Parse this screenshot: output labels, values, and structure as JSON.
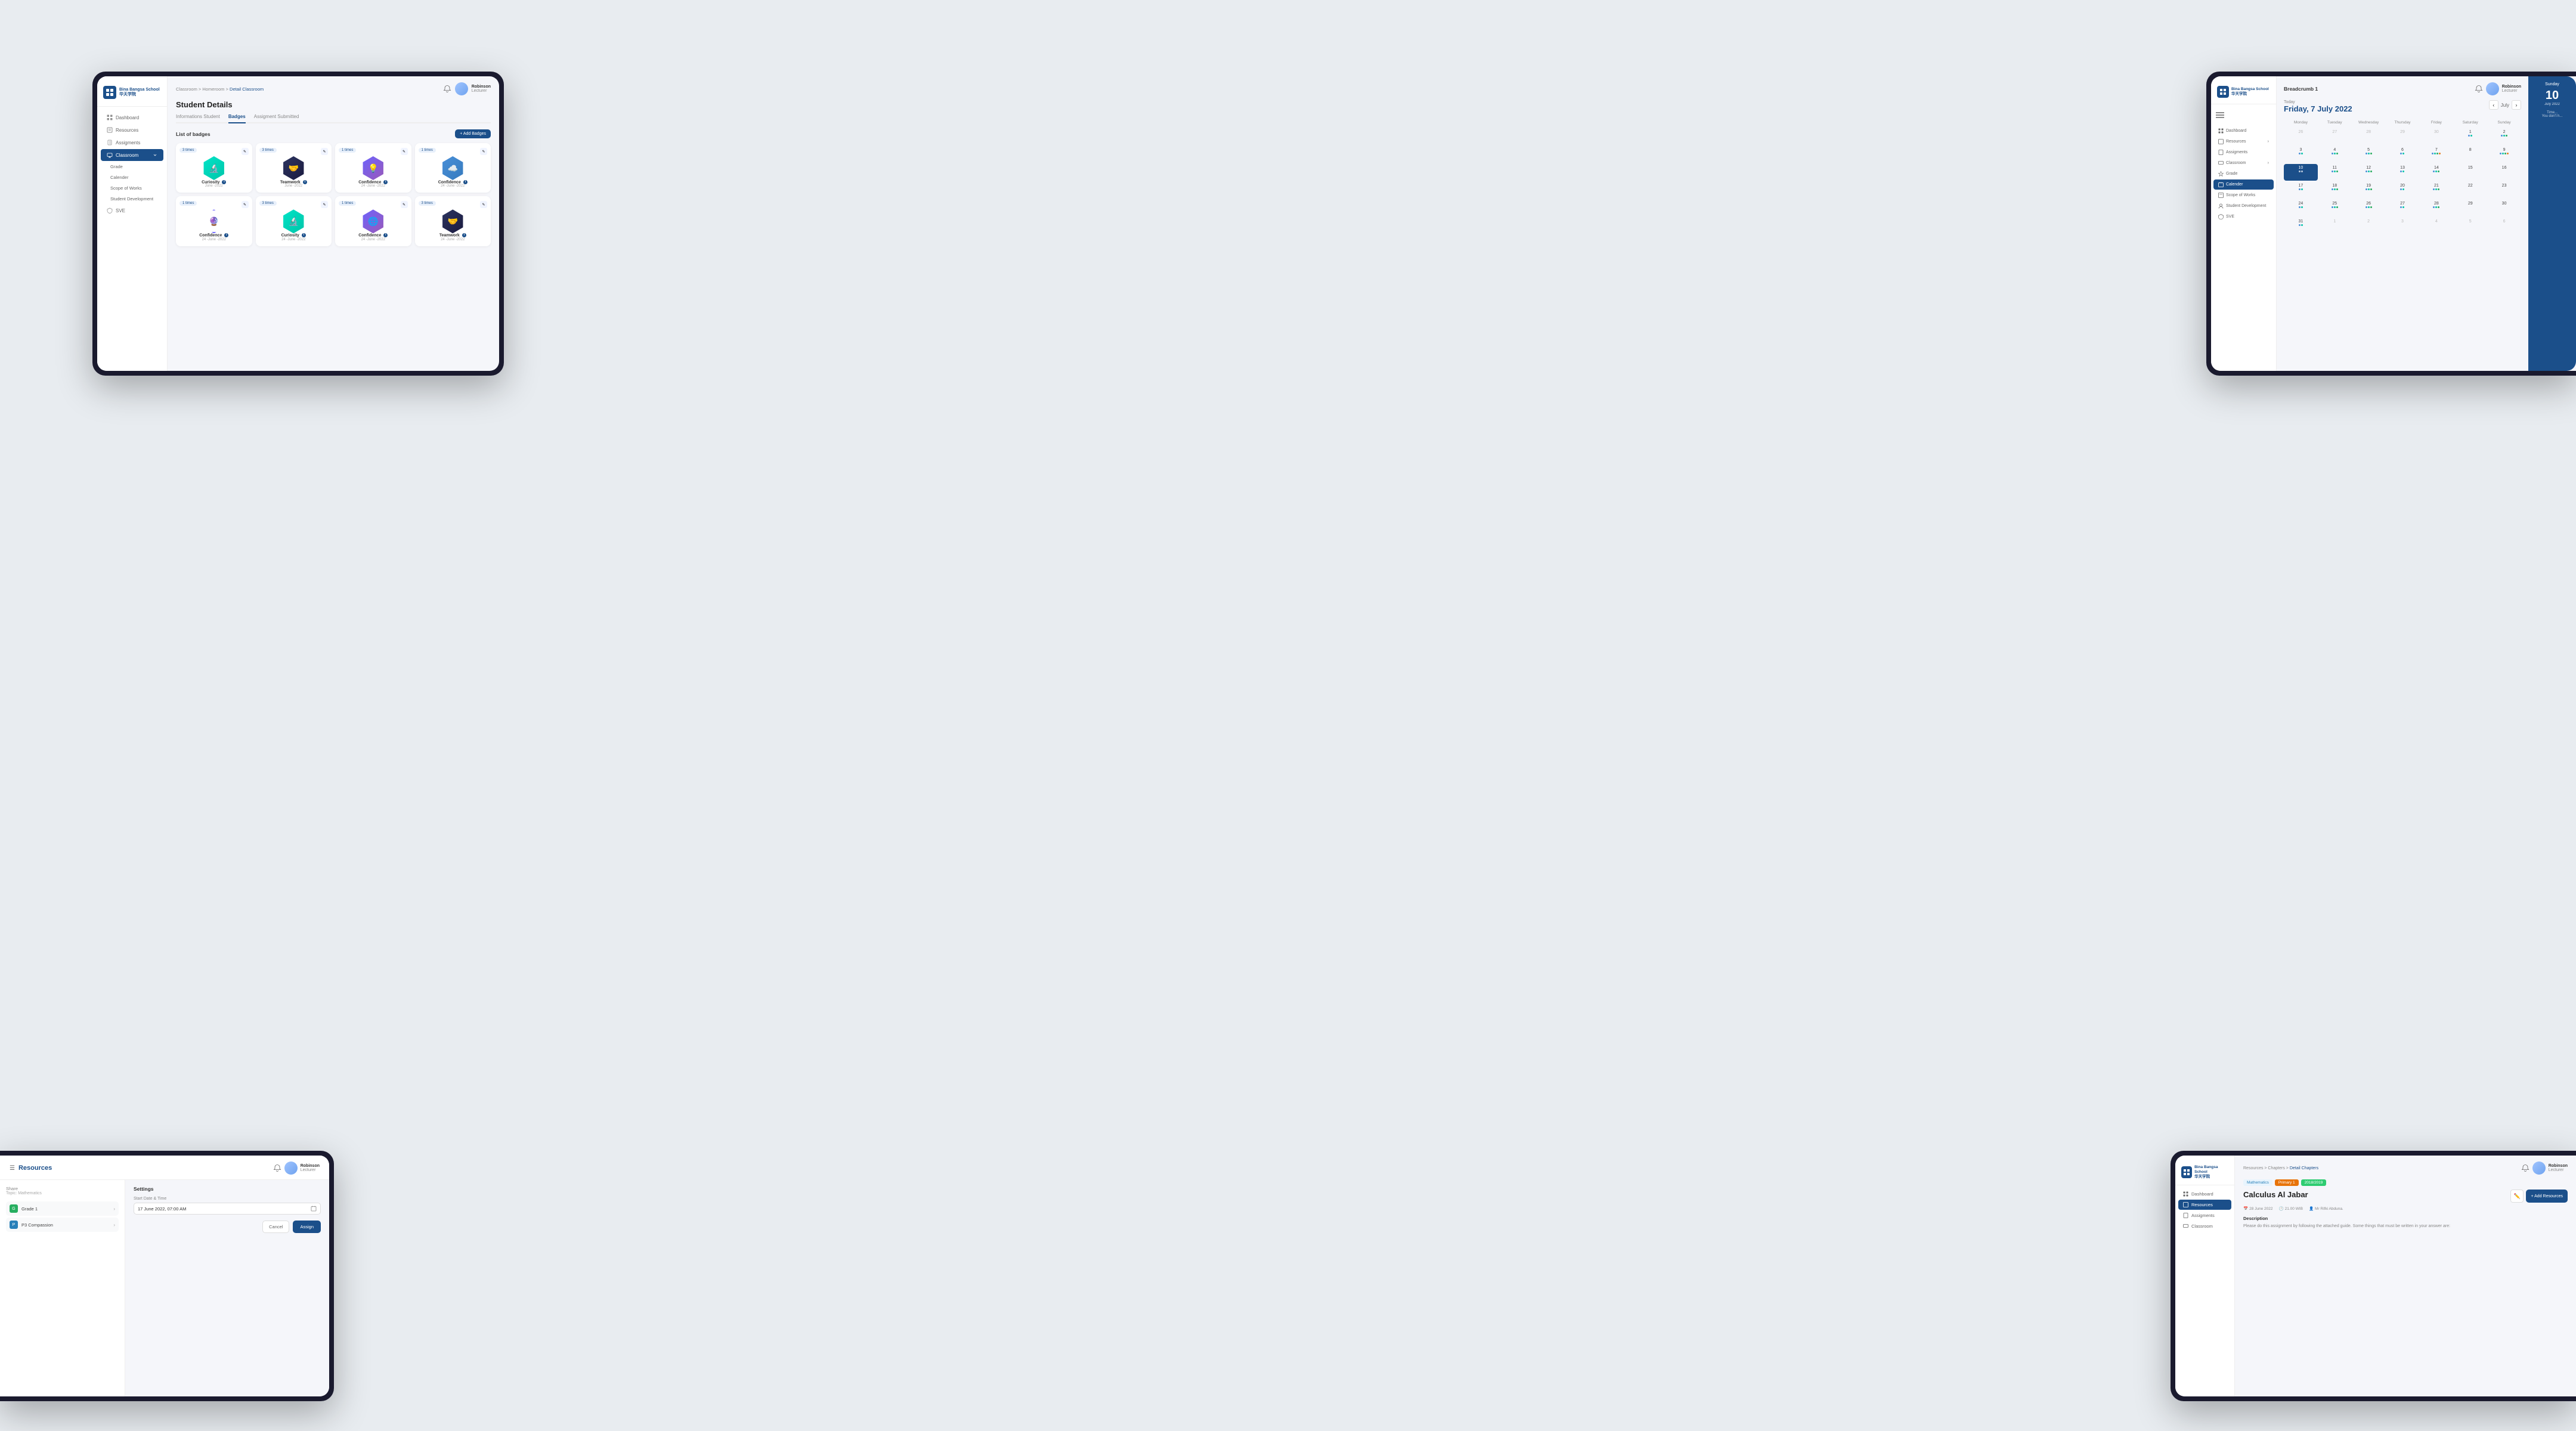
{
  "tablet1": {
    "school_name": "Bina Bangsa School",
    "school_subtitle": "华天学院",
    "breadcrumb": {
      "items": [
        "Classroom",
        "Homeroom",
        "Detail Classroom"
      ]
    },
    "user": {
      "name": "Robinson",
      "role": "Lecturer"
    },
    "page_title": "Student  Details",
    "tabs": [
      "Informations Student",
      "Badges",
      "Assigment Submitted"
    ],
    "active_tab": "Badges",
    "badges_section_title": "List of badges",
    "add_badges_label": "+ Add Badges",
    "sidebar": {
      "items": [
        {
          "label": "Dashboard",
          "icon": "grid"
        },
        {
          "label": "Resources",
          "icon": "book"
        },
        {
          "label": "Assigments",
          "icon": "clipboard"
        },
        {
          "label": "Classroom",
          "icon": "monitor",
          "active": true
        },
        {
          "label": "Grade",
          "icon": "star"
        },
        {
          "label": "Calender",
          "icon": "calendar"
        },
        {
          "label": "Scope of Works",
          "icon": "file"
        },
        {
          "label": "Student Development",
          "icon": "user"
        },
        {
          "label": "SVE",
          "icon": "shield"
        }
      ]
    },
    "badges": [
      {
        "label": "Curiosity",
        "date": "June -2022",
        "count": "3 times",
        "type": "teal",
        "icon": "🔬"
      },
      {
        "label": "Teamwork",
        "date": "June -2022",
        "count": "3 times",
        "type": "dark",
        "icon": "🤝"
      },
      {
        "label": "Confidence",
        "date": "24 -June -2022",
        "count": "1 times",
        "type": "purple",
        "icon": "💡"
      },
      {
        "label": "Confidence",
        "date": "24 -June -2022",
        "count": "1 times",
        "type": "blue",
        "icon": "☁️"
      },
      {
        "label": "Confidence",
        "date": "24 -June -2022",
        "count": "1 times",
        "type": "outline-purple",
        "icon": "🔮"
      },
      {
        "label": "Curiosity",
        "date": "24 -June -2022",
        "count": "3 times",
        "type": "teal",
        "icon": "🔬"
      },
      {
        "label": "Confidence",
        "date": "24 -June -2022",
        "count": "1 times",
        "type": "purple",
        "icon": "🌐"
      },
      {
        "label": "Teamwork",
        "date": "24 -June -2022",
        "count": "3 times",
        "type": "dark",
        "icon": "🤝"
      }
    ]
  },
  "tablet2": {
    "school_name": "Bina Bangsa School",
    "school_subtitle": "华天学院",
    "breadcrumb": "Breadcrumb 1",
    "user": {
      "name": "Robinson",
      "role": "Lecturer"
    },
    "today_label": "Today",
    "date_label": "Friday, 7 July 2022",
    "nav_month": "July",
    "sunday_label": "Sunday",
    "sunday_date": "10 July 2022",
    "sidebar": {
      "items": [
        {
          "label": "Dashboard",
          "icon": "grid"
        },
        {
          "label": "Resources",
          "icon": "book"
        },
        {
          "label": "Assigments",
          "icon": "clipboard"
        },
        {
          "label": "Classroom",
          "icon": "monitor"
        },
        {
          "label": "Grade",
          "icon": "star"
        },
        {
          "label": "Calender",
          "icon": "calendar",
          "active": true
        },
        {
          "label": "Scope of Works",
          "icon": "file"
        },
        {
          "label": "Student Development",
          "icon": "user"
        },
        {
          "label": "SVE",
          "icon": "shield"
        }
      ]
    },
    "calendar": {
      "days": [
        "Monday",
        "Tuesday",
        "Wednesday",
        "Thursday",
        "Friday",
        "Saturday",
        "Sunday"
      ],
      "weeks": [
        {
          "cells": [
            {
              "num": "26",
              "other": true,
              "dots": []
            },
            {
              "num": "27",
              "other": true,
              "dots": []
            },
            {
              "num": "28",
              "other": true,
              "dots": []
            },
            {
              "num": "29",
              "other": true,
              "dots": []
            },
            {
              "num": "30",
              "other": true,
              "dots": []
            },
            {
              "num": "1",
              "dots": [
                "blue",
                "teal"
              ]
            },
            {
              "num": "2",
              "dots": [
                "blue",
                "teal",
                "green"
              ]
            }
          ]
        },
        {
          "cells": [
            {
              "num": "3",
              "dots": [
                "blue",
                "teal"
              ]
            },
            {
              "num": "4",
              "dots": [
                "blue",
                "teal",
                "green"
              ]
            },
            {
              "num": "5",
              "dots": [
                "blue",
                "teal",
                "green"
              ]
            },
            {
              "num": "6",
              "dots": [
                "blue",
                "teal"
              ]
            },
            {
              "num": "7",
              "dots": [
                "blue",
                "teal",
                "green",
                "orange"
              ]
            },
            {
              "num": "8",
              "dots": []
            },
            {
              "num": "9",
              "dots": [
                "blue",
                "teal",
                "green",
                "orange"
              ]
            }
          ]
        },
        {
          "cells": [
            {
              "num": "10",
              "today": true,
              "dots": [
                "blue",
                "teal"
              ]
            },
            {
              "num": "11",
              "dots": [
                "blue",
                "teal",
                "green"
              ]
            },
            {
              "num": "12",
              "dots": [
                "blue",
                "teal",
                "green"
              ]
            },
            {
              "num": "13",
              "dots": [
                "blue",
                "teal"
              ]
            },
            {
              "num": "14",
              "dots": [
                "blue",
                "teal",
                "green"
              ]
            },
            {
              "num": "15",
              "dots": []
            },
            {
              "num": "16",
              "dots": []
            }
          ]
        },
        {
          "cells": [
            {
              "num": "17",
              "dots": [
                "blue",
                "teal"
              ]
            },
            {
              "num": "18",
              "dots": [
                "blue",
                "teal",
                "green"
              ]
            },
            {
              "num": "19",
              "dots": [
                "blue",
                "teal",
                "green"
              ]
            },
            {
              "num": "20",
              "dots": [
                "blue",
                "teal"
              ]
            },
            {
              "num": "21",
              "dots": [
                "blue",
                "teal",
                "green"
              ]
            },
            {
              "num": "22",
              "dots": []
            },
            {
              "num": "23",
              "dots": []
            }
          ]
        },
        {
          "cells": [
            {
              "num": "24",
              "dots": [
                "blue",
                "teal"
              ]
            },
            {
              "num": "25",
              "dots": [
                "blue",
                "teal",
                "green"
              ]
            },
            {
              "num": "26",
              "dots": [
                "blue",
                "teal",
                "green"
              ]
            },
            {
              "num": "27",
              "dots": [
                "blue",
                "teal"
              ]
            },
            {
              "num": "28",
              "dots": [
                "blue",
                "teal",
                "green"
              ]
            },
            {
              "num": "29",
              "dots": []
            },
            {
              "num": "30",
              "dots": []
            }
          ]
        },
        {
          "cells": [
            {
              "num": "31",
              "dots": [
                "blue",
                "teal"
              ]
            },
            {
              "num": "1",
              "other": true,
              "dots": []
            },
            {
              "num": "2",
              "other": true,
              "dots": []
            },
            {
              "num": "3",
              "other": true,
              "dots": []
            },
            {
              "num": "4",
              "other": true,
              "dots": []
            },
            {
              "num": "5",
              "other": true,
              "dots": []
            },
            {
              "num": "6",
              "other": true,
              "dots": []
            }
          ]
        }
      ]
    }
  },
  "tablet3": {
    "title": "Resources",
    "share_label": "Share",
    "share_topic": "Topic: Mathematics",
    "resources": [
      {
        "label": "Grade 1",
        "icon_type": "green",
        "icon": "G"
      },
      {
        "label": "P3 Compassion",
        "icon_type": "blue",
        "icon": "P"
      }
    ],
    "settings_title": "Settings",
    "start_date_label": "Start Date & Time",
    "start_date_value": "17 June 2022, 07:00 AM",
    "cancel_label": "Cancel",
    "assign_label": "Assign",
    "user": {
      "name": "Robinson",
      "role": "Lecturer"
    }
  },
  "tablet4": {
    "school_name": "Bina Bangsa School",
    "school_subtitle": "华天学院",
    "breadcrumb": {
      "items": [
        "Resources",
        "Chapters",
        "Detail Chapters"
      ]
    },
    "user": {
      "name": "Robinson",
      "role": "Lecturer"
    },
    "sidebar": {
      "items": [
        {
          "label": "Dashboard",
          "icon": "grid"
        },
        {
          "label": "Resources",
          "icon": "book",
          "active": true
        },
        {
          "label": "Assigments",
          "icon": "clipboard"
        },
        {
          "label": "Classroom",
          "icon": "monitor"
        }
      ]
    },
    "tags": [
      "Mathematics",
      "Primary 1",
      "2018/2019"
    ],
    "chapter_title": "Calculus Al Jabar",
    "meta": [
      {
        "icon": "📅",
        "text": "28 June 2022"
      },
      {
        "icon": "🕐",
        "text": "21.00 WIB"
      },
      {
        "icon": "👤",
        "text": "Mr Rifki Abduna."
      }
    ],
    "desc_label": "Description",
    "desc_text": "Please do this assignment by following the attached guide. Some things that must be written in your answer are:",
    "add_resources_label": "+ Add Resources"
  }
}
